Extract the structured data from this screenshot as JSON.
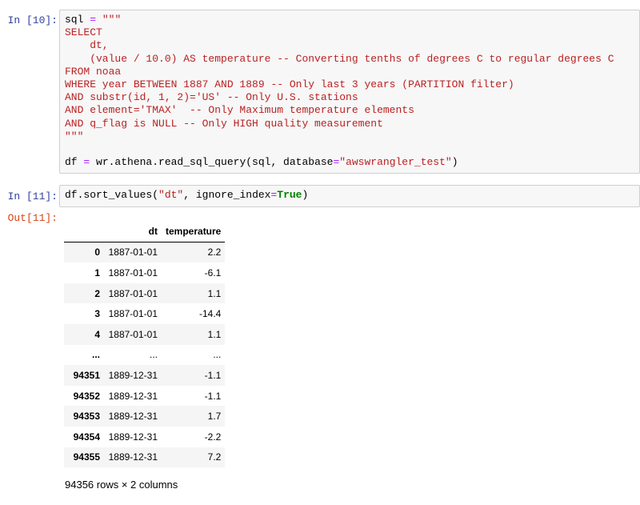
{
  "cell10": {
    "prompt": "In [10]:",
    "code_lines": [
      [
        {
          "t": "sql "
        },
        {
          "t": "=",
          "c": "o"
        },
        {
          "t": " ",
          "c": ""
        },
        {
          "t": "\"\"\"",
          "c": "s"
        }
      ],
      [
        {
          "t": "SELECT",
          "c": "s"
        }
      ],
      [
        {
          "t": "    dt,",
          "c": "s"
        }
      ],
      [
        {
          "t": "    (value / 10.0) AS temperature -- Converting tenths of degrees C to regular degrees C",
          "c": "s"
        }
      ],
      [
        {
          "t": "FROM noaa",
          "c": "s"
        }
      ],
      [
        {
          "t": "WHERE year BETWEEN 1887 AND 1889 -- Only last 3 years (PARTITION filter)",
          "c": "s"
        }
      ],
      [
        {
          "t": "AND substr(id, 1, 2)='US' -- Only U.S. stations",
          "c": "s"
        }
      ],
      [
        {
          "t": "AND element='TMAX'  -- Only Maximum temperature elements",
          "c": "s"
        }
      ],
      [
        {
          "t": "AND q_flag is NULL -- Only HIGH quality measurement",
          "c": "s"
        }
      ],
      [
        {
          "t": "\"\"\"",
          "c": "s"
        }
      ],
      [
        {
          "t": ""
        }
      ],
      [
        {
          "t": "df "
        },
        {
          "t": "=",
          "c": "o"
        },
        {
          "t": " wr.athena.read_sql_query(sql, database"
        },
        {
          "t": "=",
          "c": "o"
        },
        {
          "t": "\"awswrangler_test\"",
          "c": "s"
        },
        {
          "t": ")"
        }
      ]
    ]
  },
  "cell11": {
    "prompt": "In [11]:",
    "code_lines": [
      [
        {
          "t": "df.sort_values("
        },
        {
          "t": "\"dt\"",
          "c": "s"
        },
        {
          "t": ", ignore_index"
        },
        {
          "t": "=",
          "c": "o"
        },
        {
          "t": "True",
          "c": "k"
        },
        {
          "t": ")"
        }
      ]
    ]
  },
  "output11": {
    "prompt": "Out[11]:",
    "columns": [
      "",
      "dt",
      "temperature"
    ],
    "rows": [
      [
        "0",
        "1887-01-01",
        "2.2"
      ],
      [
        "1",
        "1887-01-01",
        "-6.1"
      ],
      [
        "2",
        "1887-01-01",
        "1.1"
      ],
      [
        "3",
        "1887-01-01",
        "-14.4"
      ],
      [
        "4",
        "1887-01-01",
        "1.1"
      ],
      [
        "...",
        "...",
        "..."
      ],
      [
        "94351",
        "1889-12-31",
        "-1.1"
      ],
      [
        "94352",
        "1889-12-31",
        "-1.1"
      ],
      [
        "94353",
        "1889-12-31",
        "1.7"
      ],
      [
        "94354",
        "1889-12-31",
        "-2.2"
      ],
      [
        "94355",
        "1889-12-31",
        "7.2"
      ]
    ],
    "shape": "94356 rows × 2 columns"
  }
}
